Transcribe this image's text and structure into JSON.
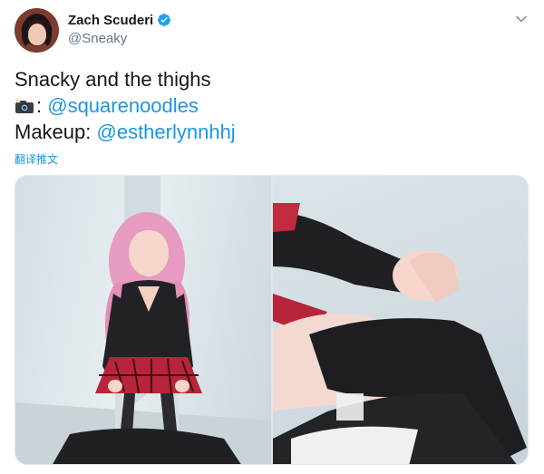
{
  "author": {
    "display_name": "Zach Scuderi",
    "handle": "@Sneaky",
    "verified": true
  },
  "tweet": {
    "line1": "Snacky and the thighs",
    "line2_prefix": ": ",
    "line2_mention": "@squarenoodles",
    "line3_prefix": "Makeup: ",
    "line3_mention": "@estherlynnhhj",
    "translate_label": "翻译推文"
  },
  "icons": {
    "verified": "verified-badge-icon",
    "caret": "chevron-down-icon",
    "camera": "camera-with-flash-emoji"
  },
  "colors": {
    "link": "#1b95e0",
    "text": "#14171a",
    "secondary": "#657786",
    "verified": "#1da1f2"
  }
}
